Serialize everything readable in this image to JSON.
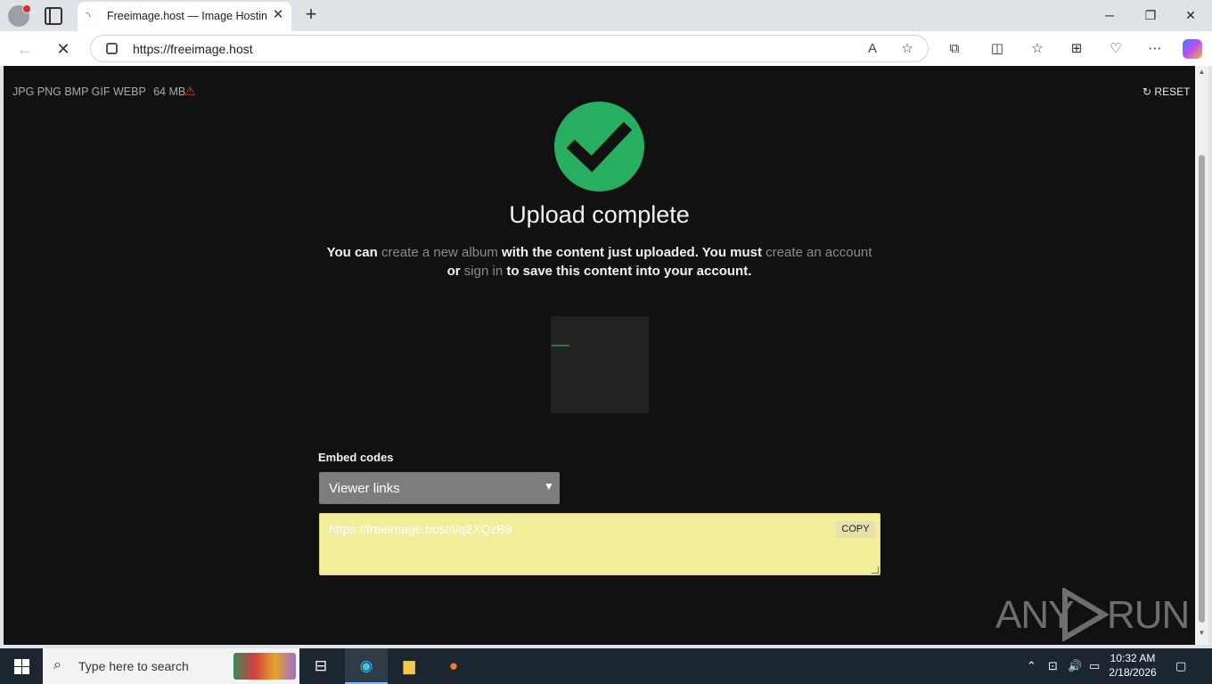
{
  "browser": {
    "tab_title": "Freeimage.host — Image Hosting",
    "url": "https://freeimage.host",
    "new_tab_symbol": "+",
    "close_symbol": "✕"
  },
  "page": {
    "formats": "JPG PNG BMP GIF WEBP",
    "max_size": "64 MB",
    "reset_label": "RESET",
    "title": "Upload complete",
    "message": {
      "p1": "You can ",
      "link_album": "create a new album",
      "p2": " with the content just uploaded. You must ",
      "link_account": "create an account",
      "p3": "or ",
      "link_signin": "sign in",
      "p4": " to save this content into your account."
    },
    "embed_label": "Embed codes",
    "embed_select": "Viewer links",
    "embed_code": "https://freeimage.host/i/q2XQzB9",
    "copy_label": "COPY"
  },
  "watermark": {
    "left": "ANY",
    "right": "RUN"
  },
  "taskbar": {
    "search_placeholder": "Type here to search",
    "time": "10:32 AM",
    "date": "2/18/2026"
  },
  "colors": {
    "success": "#27ae60",
    "code_bg": "#f2ed9b",
    "select_bg": "#7d7d7d"
  }
}
